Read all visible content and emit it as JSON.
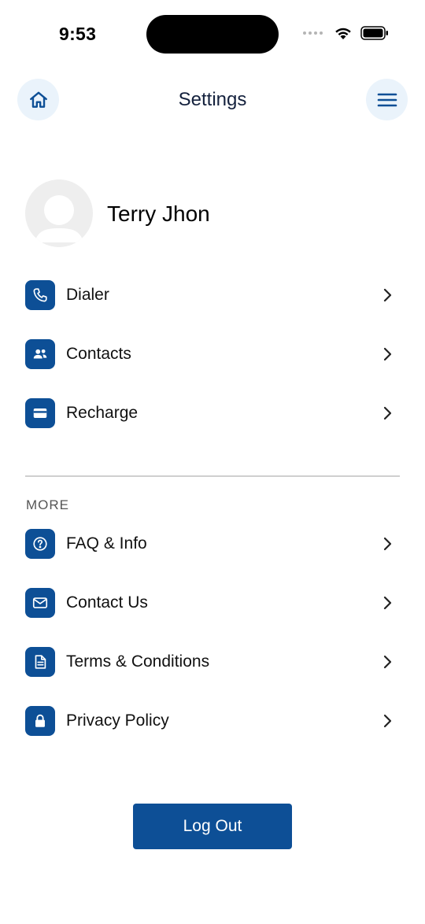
{
  "status_bar": {
    "time": "9:53"
  },
  "header": {
    "title": "Settings"
  },
  "profile": {
    "name": "Terry Jhon"
  },
  "main_items": [
    {
      "label": "Dialer",
      "icon": "phone-icon"
    },
    {
      "label": "Contacts",
      "icon": "people-icon"
    },
    {
      "label": "Recharge",
      "icon": "card-icon"
    }
  ],
  "more_section": {
    "title": "MORE",
    "items": [
      {
        "label": "FAQ & Info",
        "icon": "question-icon"
      },
      {
        "label": "Contact Us",
        "icon": "mail-icon"
      },
      {
        "label": "Terms & Conditions",
        "icon": "document-icon"
      },
      {
        "label": "Privacy Policy",
        "icon": "lock-icon"
      }
    ]
  },
  "logout": {
    "label": "Log Out"
  },
  "colors": {
    "accent": "#0d4f96",
    "header_button_bg": "#eaf3fb",
    "title_text": "#14213d"
  }
}
